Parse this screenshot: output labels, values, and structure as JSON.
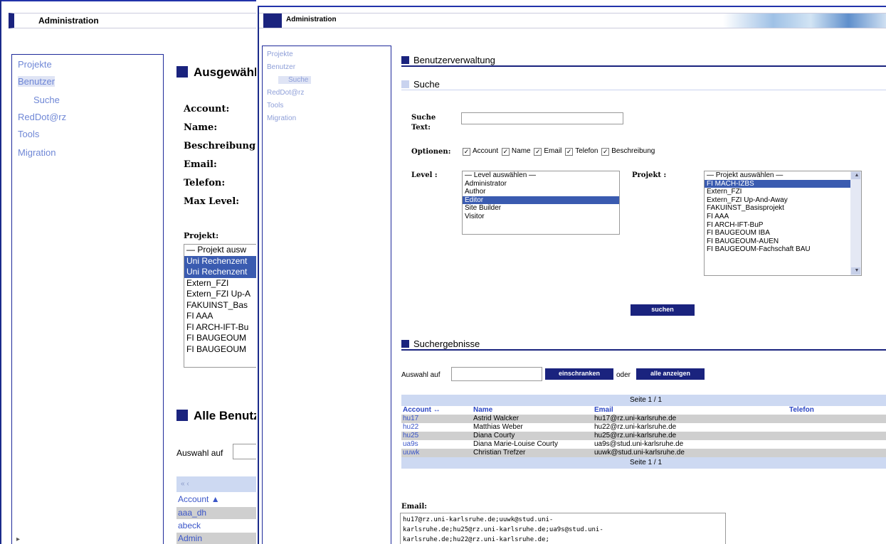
{
  "back_window": {
    "title": "Administration",
    "nav": [
      "Projekte",
      "Benutzer",
      "Suche",
      "RedDot@rz",
      "Tools",
      "Migration"
    ],
    "section_selected": "Ausgewähl",
    "fields": [
      "Account:",
      "Name:",
      "Beschreibung:",
      "Email:",
      "Telefon:",
      "Max Level:"
    ],
    "projekt_label": "Projekt:",
    "projekt_list": [
      "— Projekt ausw",
      "Uni Rechenzent",
      "Uni Rechenzent",
      "Extern_FZI",
      "Extern_FZI Up-A",
      "FAKUINST_Bas",
      "FI AAA",
      "FI ARCH-IFT-Bu",
      "FI BAUGEOUM",
      "FI BAUGEOUM"
    ],
    "section_all": "Alle Benutz",
    "filter_label": "Auswahl auf",
    "pager": "« ‹",
    "account_header": "Account ▲",
    "accounts": [
      "aaa_dh",
      "abeck",
      "Admin"
    ]
  },
  "front_window": {
    "title": "Administration",
    "nav": [
      "Projekte",
      "Benutzer",
      "Suche",
      "RedDot@rz",
      "Tools",
      "Migration"
    ],
    "heading": "Benutzerverwaltung",
    "search_heading": "Suche",
    "search_label": "Suche Text:",
    "options_label": "Optionen:",
    "options": [
      "Account",
      "Name",
      "Email",
      "Telefon",
      "Beschreibung"
    ],
    "level_label": "Level :",
    "levels": [
      "— Level auswählen —",
      "Administrator",
      "Author",
      "Editor",
      "Site Builder",
      "Visitor"
    ],
    "projekt_label": "Projekt :",
    "projects": [
      "— Projekt auswählen —",
      "FI MACH-IZBS",
      "Extern_FZI",
      "Extern_FZI Up-And-Away",
      "FAKUINST_Basisprojekt",
      "FI AAA",
      "FI ARCH-IFT-BuP",
      "FI BAUGEOUM IBA",
      "FI BAUGEOUM-AUEN",
      "FI BAUGEOUM-Fachschaft BAU"
    ],
    "search_button": "suchen",
    "results_heading": "Suchergebnisse",
    "filter_label": "Auswahl auf",
    "restrict_button": "einschranken",
    "oder": "oder",
    "show_all_button": "alle anzeigen",
    "page_label": "Seite 1 / 1",
    "columns": [
      "Account ↔",
      "Name",
      "Email",
      "Telefon"
    ],
    "rows": [
      {
        "account": "hu17",
        "name": "Astrid Walcker",
        "email": "hu17@rz.uni-karlsruhe.de",
        "telefon": ""
      },
      {
        "account": "hu22",
        "name": "Matthias Weber",
        "email": "hu22@rz.uni-karlsruhe.de",
        "telefon": ""
      },
      {
        "account": "hu25",
        "name": "Diana Courty",
        "email": "hu25@rz.uni-karlsruhe.de",
        "telefon": ""
      },
      {
        "account": "ua9s",
        "name": "Diana Marie-Louise Courty",
        "email": "ua9s@stud.uni-karlsruhe.de",
        "telefon": ""
      },
      {
        "account": "uuwk",
        "name": "Christian Trefzer",
        "email": "uuwk@stud.uni-karlsruhe.de",
        "telefon": ""
      }
    ],
    "email_label": "Email:",
    "email_lines": [
      "hu17@rz.uni-karlsruhe.de;uuwk@stud.uni-",
      "karlsruhe.de;hu25@rz.uni-karlsruhe.de;ua9s@stud.uni-",
      "karlsruhe.de;hu22@rz.uni-karlsruhe.de;"
    ]
  }
}
